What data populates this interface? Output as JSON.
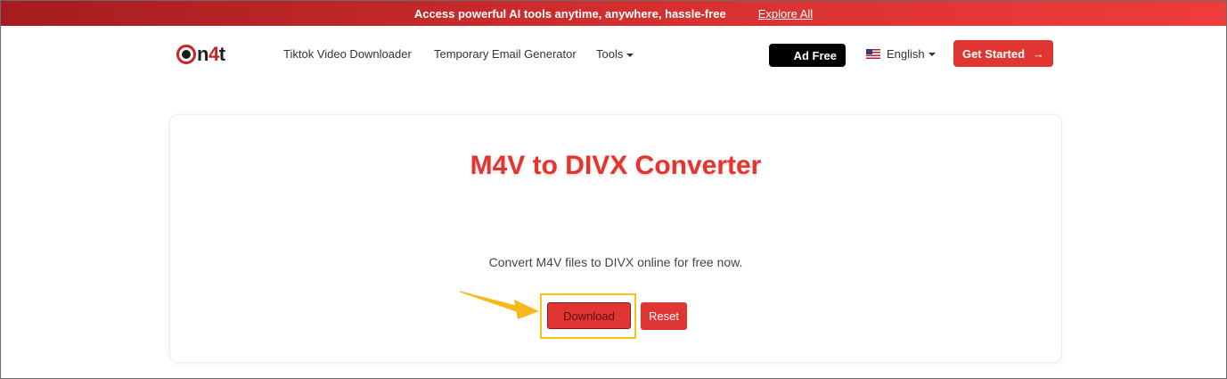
{
  "promo": {
    "text": "Access powerful AI tools anytime, anywhere, hassle-free",
    "link": "Explore All"
  },
  "logo": {
    "text_prefix": "n",
    "text_highlight": "4",
    "text_suffix": "t"
  },
  "nav": {
    "items": [
      {
        "label": "Tiktok Video Downloader"
      },
      {
        "label": "Temporary Email Generator"
      },
      {
        "label": "Tools"
      }
    ],
    "ad_free": "Ad Free",
    "language": "English",
    "get_started": "Get Started"
  },
  "converter": {
    "title": "M4V to DIVX Converter",
    "subtitle": "Convert M4V files to DIVX online for free now.",
    "download_label": "Download",
    "reset_label": "Reset"
  },
  "colors": {
    "accent": "#e13533",
    "highlight": "#f5c518",
    "pointer": "#f7b81a"
  },
  "icons": {
    "arrow": "→"
  }
}
